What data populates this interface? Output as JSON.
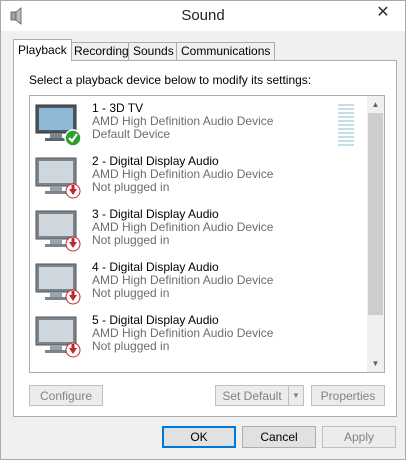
{
  "window": {
    "title": "Sound"
  },
  "tabs": [
    {
      "label": "Playback",
      "active": true
    },
    {
      "label": "Recording",
      "active": false
    },
    {
      "label": "Sounds",
      "active": false
    },
    {
      "label": "Communications",
      "active": false
    }
  ],
  "playback": {
    "instruction": "Select a playback device below to modify its settings:",
    "devices": [
      {
        "name": "1 - 3D TV",
        "driver": "AMD High Definition Audio Device",
        "status": "Default Device",
        "badge": "green-check-icon"
      },
      {
        "name": "2 - Digital Display Audio",
        "driver": "AMD High Definition Audio Device",
        "status": "Not plugged in",
        "badge": "red-down-arrow-icon"
      },
      {
        "name": "3 - Digital Display Audio",
        "driver": "AMD High Definition Audio Device",
        "status": "Not plugged in",
        "badge": "red-down-arrow-icon"
      },
      {
        "name": "4 - Digital Display Audio",
        "driver": "AMD High Definition Audio Device",
        "status": "Not plugged in",
        "badge": "red-down-arrow-icon"
      },
      {
        "name": "5 - Digital Display Audio",
        "driver": "AMD High Definition Audio Device",
        "status": "Not plugged in",
        "badge": "red-down-arrow-icon"
      }
    ],
    "buttons": {
      "configure": "Configure",
      "set_default": "Set Default",
      "properties": "Properties"
    }
  },
  "dialog_buttons": {
    "ok": "OK",
    "cancel": "Cancel",
    "apply": "Apply"
  },
  "colors": {
    "accent": "#0078d7",
    "default_check": "#2ca02c",
    "unplugged_arrow": "#c1272d",
    "secondary_text": "#6d6d6d"
  }
}
